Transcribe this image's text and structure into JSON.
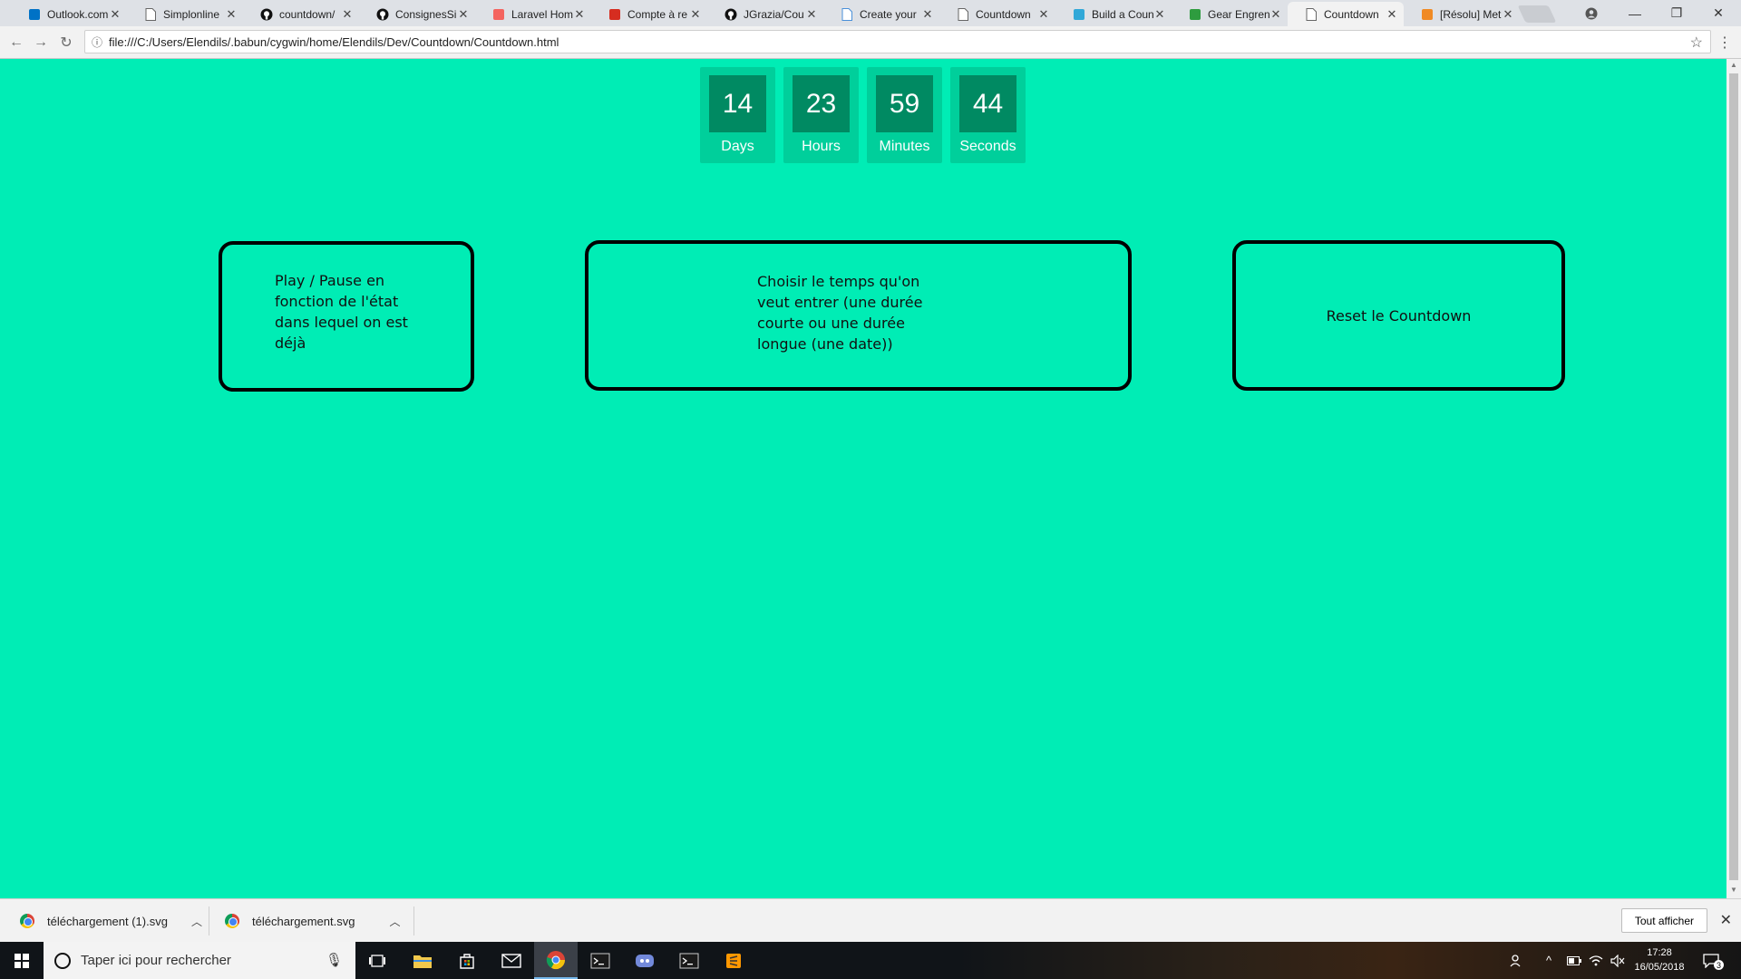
{
  "browser": {
    "tabs": [
      {
        "title": "Outlook.com",
        "favicon": "outlook-icon",
        "color": "#0072c6",
        "active": false
      },
      {
        "title": "Simplonline",
        "favicon": "page-icon",
        "color": "#666666",
        "active": false
      },
      {
        "title": "countdown/",
        "favicon": "github-icon",
        "color": "#111111",
        "active": false
      },
      {
        "title": "ConsignesSi",
        "favicon": "github-icon",
        "color": "#111111",
        "active": false
      },
      {
        "title": "Laravel Hom",
        "favicon": "laravel-icon",
        "color": "#f4645f",
        "active": false
      },
      {
        "title": "Compte à re",
        "favicon": "swirl-icon",
        "color": "#d62d20",
        "active": false
      },
      {
        "title": "JGrazia/Cou",
        "favicon": "github-icon",
        "color": "#111111",
        "active": false
      },
      {
        "title": "Create your",
        "favicon": "doc-icon",
        "color": "#4a90d9",
        "active": false
      },
      {
        "title": "Countdown",
        "favicon": "page-icon",
        "color": "#666666",
        "active": false
      },
      {
        "title": "Build a Coun",
        "favicon": "sitepoint-icon",
        "color": "#31a8d8",
        "active": false
      },
      {
        "title": "Gear Engren",
        "favicon": "px-icon",
        "color": "#2e9c3f",
        "active": false
      },
      {
        "title": "Countdown",
        "favicon": "page-icon",
        "color": "#666666",
        "active": true
      },
      {
        "title": "[Résolu] Met",
        "favicon": "ccm-icon",
        "color": "#f08a24",
        "active": false
      }
    ],
    "tab_close_glyph": "✕",
    "window_controls": {
      "profile": "profile-icon",
      "minimize": "—",
      "restore": "❐",
      "close": "✕"
    },
    "url": "file:///C:/Users/Elendils/.babun/cygwin/home/Elendils/Dev/Countdown/Countdown.html"
  },
  "countdown": {
    "units": [
      {
        "value": "14",
        "label": "Days"
      },
      {
        "value": "23",
        "label": "Hours"
      },
      {
        "value": "59",
        "label": "Minutes"
      },
      {
        "value": "44",
        "label": "Seconds"
      }
    ]
  },
  "boxes": {
    "play_pause": "Play / Pause en fonction de l'état dans lequel on est déjà",
    "choose_time": "Choisir le temps qu'on veut entrer (une durée courte ou une durée longue (une date))",
    "reset": "Reset le Countdown"
  },
  "downloads": {
    "items": [
      {
        "filename": "téléchargement (1).svg"
      },
      {
        "filename": "téléchargement.svg"
      }
    ],
    "show_all": "Tout afficher"
  },
  "taskbar": {
    "search_placeholder": "Taper ici pour rechercher",
    "apps": [
      {
        "name": "task-view-icon",
        "color": "#ffffff",
        "active": false
      },
      {
        "name": "file-explorer-icon",
        "color": "#f2c94c",
        "active": false
      },
      {
        "name": "store-icon",
        "color": "#ffffff",
        "active": false
      },
      {
        "name": "mail-icon",
        "color": "#ffffff",
        "active": false
      },
      {
        "name": "chrome-icon",
        "color": "#db4437",
        "active": true
      },
      {
        "name": "terminal-icon",
        "color": "#cccccc",
        "active": false
      },
      {
        "name": "discord-icon",
        "color": "#7289da",
        "active": false
      },
      {
        "name": "terminal-icon",
        "color": "#cccccc",
        "active": false
      },
      {
        "name": "sublime-text-icon",
        "color": "#ff9800",
        "active": false
      }
    ],
    "time": "17:28",
    "date": "16/05/2018",
    "notification_count": "3"
  },
  "colors": {
    "page_background": "#00edb5",
    "countdown_unit_bg": "#00cf9b",
    "countdown_number_bg": "#008a62"
  }
}
